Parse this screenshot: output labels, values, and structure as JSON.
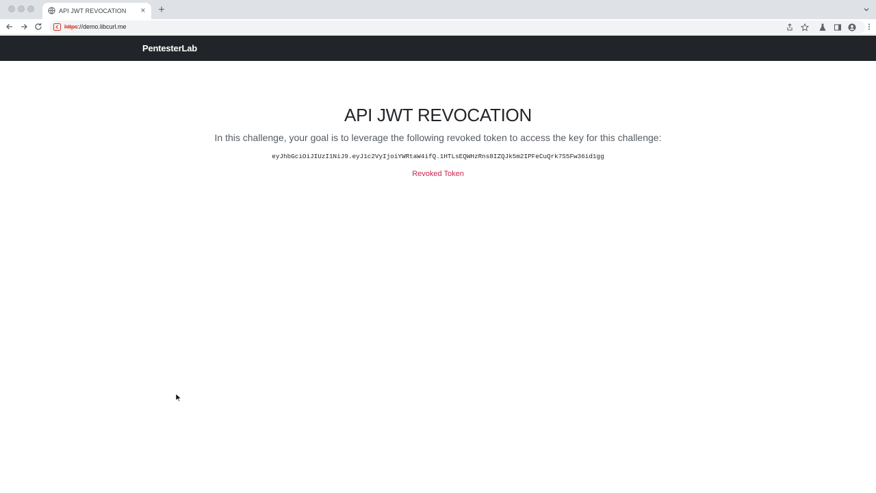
{
  "browser": {
    "tab_title": "API JWT REVOCATION",
    "url_scheme": "https",
    "url_rest": "://demo.libcurl.me"
  },
  "navbar": {
    "brand": "PentesterLab"
  },
  "main": {
    "title": "API JWT REVOCATION",
    "lead": "In this challenge, your goal is to leverage the following revoked token to access the key for this challenge:",
    "token": "eyJhbGciOiJIUzI1NiJ9.eyJ1c2VyIjoiYWRtaW4ifQ.1HTLsEQWHzRns8IZQJk5m2IPFeCuQrk7S5Fw36id1gg",
    "revoked_link": "Revoked Token"
  },
  "colors": {
    "navbar_bg": "#212529",
    "link": "#c7254e",
    "insecure_scheme": "#d93025"
  }
}
